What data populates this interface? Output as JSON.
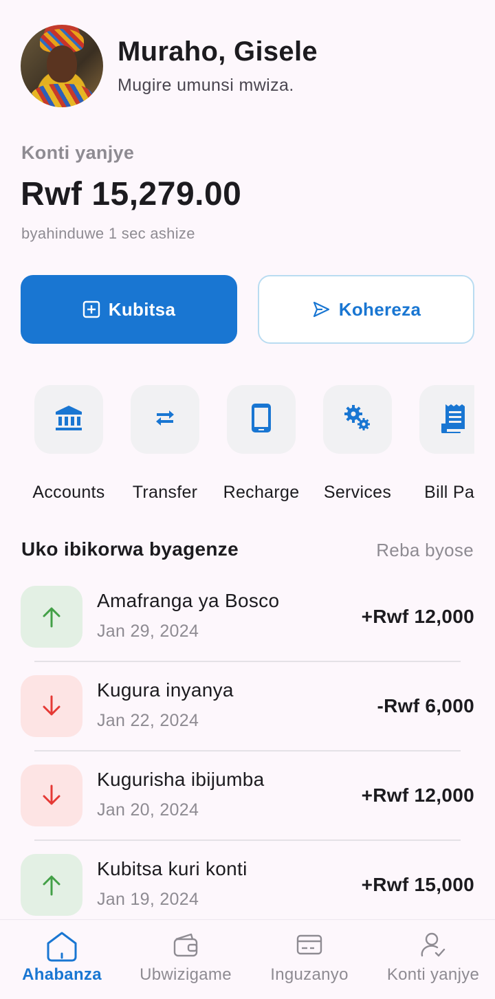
{
  "header": {
    "greeting": "Muraho, Gisele",
    "subtitle": "Mugire umunsi mwiza."
  },
  "balance": {
    "label": "Konti yanjye",
    "amount": "Rwf 15,279.00",
    "updated": "byahinduwe 1 sec ashize"
  },
  "actions": {
    "deposit_label": "Kubitsa",
    "send_label": "Kohereza"
  },
  "quick_actions": [
    {
      "label": "Accounts",
      "icon": "bank-icon"
    },
    {
      "label": "Transfer",
      "icon": "swap-icon"
    },
    {
      "label": "Recharge",
      "icon": "phone-icon"
    },
    {
      "label": "Services",
      "icon": "gears-icon"
    },
    {
      "label": "Bill Pay",
      "icon": "receipt-icon"
    }
  ],
  "recent": {
    "title": "Uko ibikorwa byagenze",
    "see_all": "Reba byose",
    "transactions": [
      {
        "name": "Amafranga ya Bosco",
        "date": "Jan 29, 2024",
        "amount": "+Rwf 12,000",
        "direction": "in"
      },
      {
        "name": "Kugura inyanya",
        "date": "Jan 22, 2024",
        "amount": "-Rwf 6,000",
        "direction": "out"
      },
      {
        "name": "Kugurisha ibijumba",
        "date": "Jan 20, 2024",
        "amount": "+Rwf 12,000",
        "direction": "out"
      },
      {
        "name": "Kubitsa kuri konti",
        "date": "Jan 19, 2024",
        "amount": "+Rwf 15,000",
        "direction": "in"
      }
    ]
  },
  "bottom_nav": [
    {
      "label": "Ahabanza",
      "icon": "home-icon",
      "active": true
    },
    {
      "label": "Ubwizigame",
      "icon": "wallet-icon",
      "active": false
    },
    {
      "label": "Inguzanyo",
      "icon": "card-icon",
      "active": false
    },
    {
      "label": "Konti yanjye",
      "icon": "profile-icon",
      "active": false
    }
  ],
  "colors": {
    "primary": "#1976d2",
    "background": "#fdf7fc",
    "up_bg": "#e3f0e4",
    "up_arrow": "#43a047",
    "down_bg": "#fde4e4",
    "down_arrow": "#e53935"
  }
}
